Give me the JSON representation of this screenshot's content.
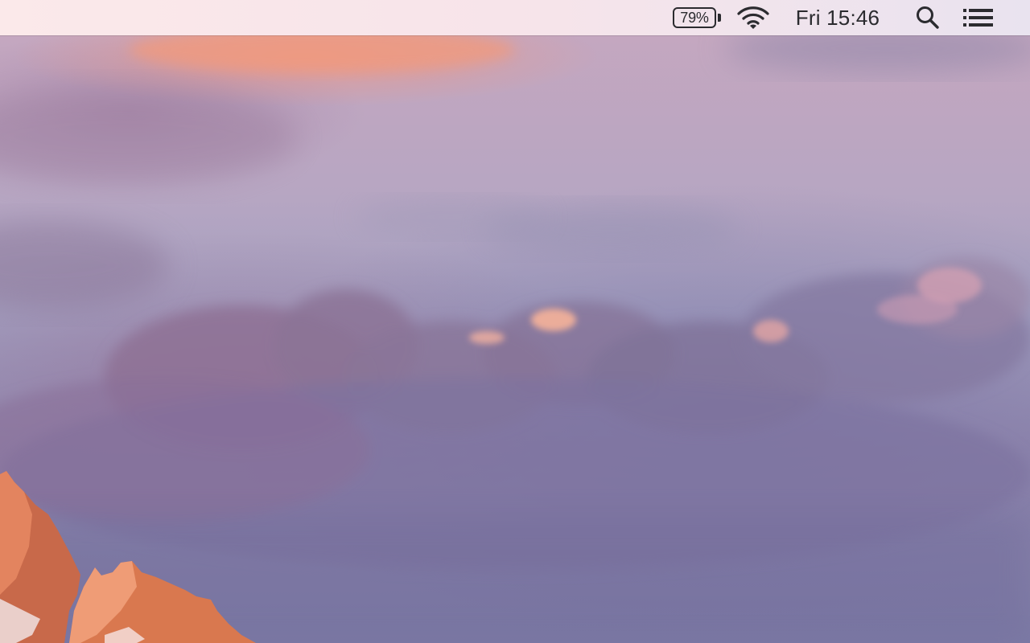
{
  "menubar": {
    "battery": {
      "percent_label": "79%",
      "icon": "battery-icon"
    },
    "wifi": {
      "icon": "wifi-icon"
    },
    "clock": {
      "label": "Fri 15:46"
    },
    "spotlight": {
      "icon": "search-icon"
    },
    "notification_center": {
      "icon": "list-icon"
    }
  },
  "wallpaper": {
    "colors": {
      "sky_top": "#c7a7bf",
      "sky_mid": "#a3a0c0",
      "sky_bottom": "#7c7aa5",
      "cloud_glow": "#f0a089",
      "mountain_lit": "#e07a57"
    }
  }
}
